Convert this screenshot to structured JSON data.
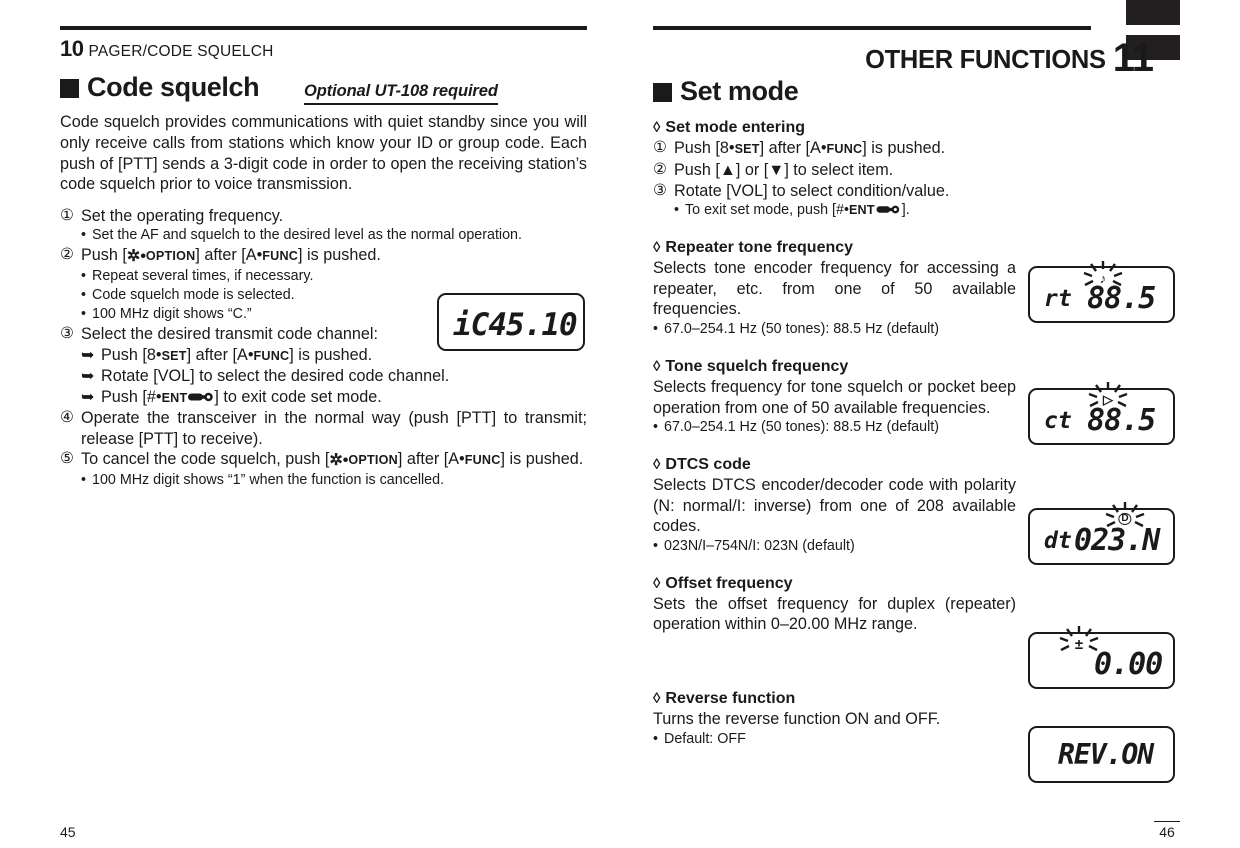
{
  "left_page": {
    "running_head": {
      "chapter_number": "10",
      "chapter_title": "PAGER/CODE SQUELCH"
    },
    "section_title": "Code squelch",
    "option_badge": "Optional UT-108 required",
    "intro": "Code squelch provides communications with quiet standby since you will only receive calls from stations which know your ID or group code. Each push of [PTT] sends a 3-digit code in order to open the receiving station’s code squelch prior to voice transmission.",
    "steps": [
      {
        "marker": "①",
        "text": "Set the operating frequency.",
        "bullets": [
          {
            "marker": "•",
            "text": "Set the AF and squelch to the desired level as the normal operation."
          }
        ]
      },
      {
        "marker": "②",
        "text_parts": {
          "pre": "Push [",
          "key1": "✲•",
          "key1sc": "OPTION",
          "mid": "] after [A•",
          "key2sc": "FUNC",
          "post": "] is pushed."
        },
        "bullets": [
          {
            "marker": "•",
            "text": "Repeat several times, if necessary."
          },
          {
            "marker": "•",
            "text": "Code squelch mode is selected."
          },
          {
            "marker": "•",
            "text": "100 MHz digit shows “C.”"
          }
        ]
      },
      {
        "marker": "③",
        "text": "Select the desired transmit code channel:",
        "bullets": [
          {
            "marker": "➥",
            "pre": "Push [8•",
            "sc": "SET",
            "post": "] after [A•",
            "sc2": "FUNC",
            "post2": "] is pushed."
          },
          {
            "marker": "➥",
            "text": "Rotate [VOL] to select the desired code channel."
          },
          {
            "marker": "➥",
            "pre": "Push [#•",
            "sc": "ENT",
            "icon": "key-icon",
            "post": "] to exit code set mode."
          }
        ]
      },
      {
        "marker": "④",
        "text": "Operate the transceiver in the normal way (push [PTT] to transmit; release [PTT] to receive).",
        "bullets": []
      },
      {
        "marker": "⑤",
        "text_parts": {
          "pre": "To cancel the code squelch, push [",
          "key1": "✲•",
          "key1sc": "OPTION",
          "mid": "] after [A•",
          "key2sc": "FUNC",
          "post": "] is pushed."
        },
        "bullets": [
          {
            "marker": "•",
            "text": "100 MHz digit shows “1” when the function is cancelled."
          }
        ]
      }
    ],
    "lcd": {
      "value": "iC45.10"
    },
    "folio": "45"
  },
  "right_page": {
    "running_head": {
      "chapter_number": "11",
      "chapter_title": "OTHER FUNCTIONS"
    },
    "section_title": "Set mode",
    "blocks": [
      {
        "heading": "Set mode entering",
        "steps": [
          {
            "marker": "①",
            "pre": "Push [8•",
            "sc": "SET",
            "post": "] after [A•",
            "sc2": "FUNC",
            "post2": "] is pushed."
          },
          {
            "marker": "②",
            "text": "Push [▲] or [▼] to select item."
          },
          {
            "marker": "③",
            "text": "Rotate [VOL] to select condition/value."
          }
        ],
        "bullets": [
          {
            "marker": "•",
            "pre": "To exit set mode, push [#•",
            "sc": "ENT",
            "icon": "key-icon",
            "post": "]."
          }
        ]
      },
      {
        "heading": "Repeater tone frequency",
        "body": "Selects tone encoder frequency for accessing a repeater, etc. from one of 50 available frequencies.",
        "bullets": [
          {
            "marker": "•",
            "text": "67.0–254.1 Hz (50 tones): 88.5 Hz (default)"
          }
        ],
        "lcd": {
          "label": "rt",
          "value": "88.5",
          "indicator": "blink-burst",
          "indicator_glyph": "♪"
        }
      },
      {
        "heading": "Tone squelch frequency",
        "body": "Selects frequency for tone squelch or pocket beep operation from one of 50 available frequencies.",
        "bullets": [
          {
            "marker": "•",
            "text": "67.0–254.1 Hz (50 tones): 88.5 Hz (default)"
          }
        ],
        "lcd": {
          "label": "ct",
          "value": "88.5",
          "indicator": "blink-burst",
          "indicator_glyph": "▷"
        }
      },
      {
        "heading": "DTCS code",
        "body": "Selects DTCS encoder/decoder code with polarity (N: normal/I: inverse) from one of 208 available codes.",
        "bullets": [
          {
            "marker": "•",
            "text": "023N/I–754N/I: 023N (default)"
          }
        ],
        "lcd": {
          "label": "dt",
          "value": "023.N",
          "indicator": "blink-burst",
          "indicator_glyph": "D"
        }
      },
      {
        "heading": "Offset frequency",
        "body": "Sets the offset frequency for duplex (repeater) operation within 0–20.00 MHz range.",
        "bullets": [],
        "lcd": {
          "label": "",
          "value": "0.00",
          "indicator": "blink-burst",
          "indicator_glyph": "±"
        }
      },
      {
        "heading": "Reverse function",
        "body": "Turns the reverse function ON and OFF.",
        "bullets": [
          {
            "marker": "•",
            "text": "Default: OFF"
          }
        ],
        "lcd": {
          "label": "",
          "value": "REV.ON",
          "indicator": "none",
          "indicator_glyph": ""
        }
      }
    ],
    "folio": "46"
  }
}
